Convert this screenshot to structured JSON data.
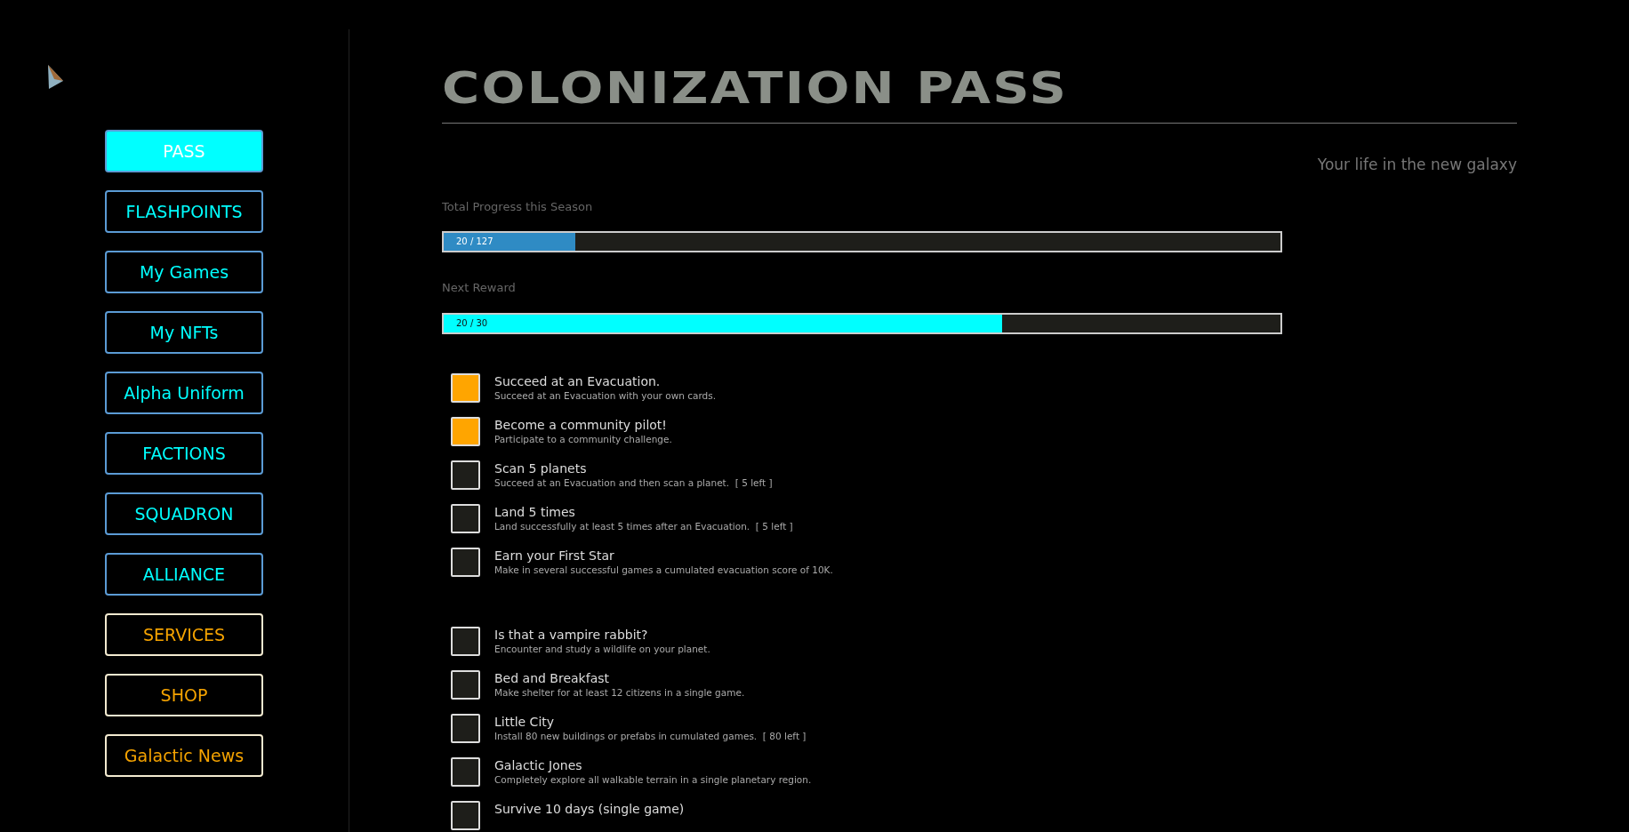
{
  "sidebar": {
    "items": [
      {
        "label": "PASS",
        "kind": "main",
        "selected": true
      },
      {
        "label": "FLASHPOINTS",
        "kind": "main",
        "selected": false
      },
      {
        "label": "My Games",
        "kind": "main",
        "selected": false
      },
      {
        "label": "My NFTs",
        "kind": "main",
        "selected": false
      },
      {
        "label": "Alpha Uniform",
        "kind": "main",
        "selected": false
      },
      {
        "label": "FACTIONS",
        "kind": "main",
        "selected": false
      },
      {
        "label": "SQUADRON",
        "kind": "main",
        "selected": false
      },
      {
        "label": "ALLIANCE",
        "kind": "main",
        "selected": false
      },
      {
        "label": "SERVICES",
        "kind": "extra",
        "selected": false
      },
      {
        "label": "SHOP",
        "kind": "extra",
        "selected": false
      },
      {
        "label": "Galactic News",
        "kind": "extra",
        "selected": false
      }
    ]
  },
  "title": "COLONIZATION PASS",
  "subtitle": "Your life in the new galaxy",
  "progress": [
    {
      "label": "Total Progress this Season",
      "reading": "20 / 127",
      "level": 0.157,
      "kind": "season"
    },
    {
      "label": "Next Reward",
      "reading": "20 / 30",
      "level": 0.667,
      "kind": "reward"
    }
  ],
  "task_groups": [
    {
      "tasks": [
        {
          "title": "Succeed at an Evacuation.",
          "description": "Succeed at an Evacuation with your own cards.",
          "checked": true
        },
        {
          "title": "Become a community pilot!",
          "description": "Participate to a community challenge.",
          "checked": true
        },
        {
          "title": "Scan 5 planets",
          "description": "Succeed at an Evacuation and then scan a planet.  [ 5 left ]",
          "checked": false
        },
        {
          "title": "Land 5 times",
          "description": "Land successfully at least 5 times after an Evacuation.  [ 5 left ]",
          "checked": false
        },
        {
          "title": "Earn your First Star",
          "description": "Make in several successful games a cumulated evacuation score of 10K.",
          "checked": false
        }
      ]
    },
    {
      "tasks": [
        {
          "title": "Is that a vampire rabbit?",
          "description": "Encounter and study a wildlife on your planet.",
          "checked": false
        },
        {
          "title": "Bed and Breakfast",
          "description": "Make shelter for at least 12 citizens in a single game.",
          "checked": false
        },
        {
          "title": "Little City",
          "description": "Install 80 new buildings or prefabs in cumulated games.  [ 80 left ]",
          "checked": false
        },
        {
          "title": "Galactic Jones",
          "description": "Completely explore all walkable terrain in a single planetary region.",
          "checked": false
        },
        {
          "title": "Survive 10 days (single game)",
          "checked": false
        }
      ]
    }
  ]
}
